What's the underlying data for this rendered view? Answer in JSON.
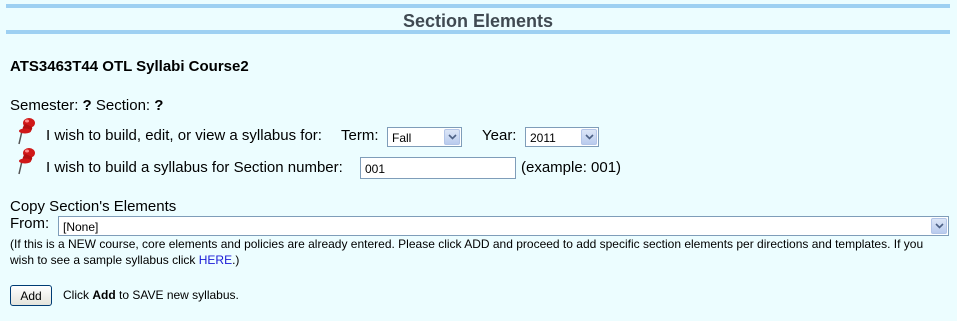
{
  "header": {
    "title": "Section Elements"
  },
  "course": {
    "title": "ATS3463T44 OTL Syllabi Course2"
  },
  "semester": {
    "semester_label": "Semester:",
    "semester_value": "?",
    "section_label": "Section:",
    "section_value": "?"
  },
  "build_row": {
    "text": "I wish to build, edit, or view a syllabus for:",
    "term_label": "Term:",
    "term_value": "Fall",
    "year_label": "Year:",
    "year_value": "2011"
  },
  "section_row": {
    "text": "I wish to build a syllabus for Section number:",
    "section_number_value": "001",
    "example_text": "(example: 001)"
  },
  "copy": {
    "heading": "Copy Section's Elements",
    "from_label": "From:",
    "from_value": "[None]"
  },
  "help": {
    "text_before_link": "(If this is a NEW course, core elements and policies are already entered. Please click ADD and proceed to add specific section elements per directions and templates. If you wish to see a sample syllabus click ",
    "link_text": "HERE",
    "text_after_link": ".)"
  },
  "actions": {
    "add_label": "Add",
    "hint_prefix": "Click",
    "hint_bold": "Add",
    "hint_suffix": "to SAVE new syllabus."
  },
  "colors": {
    "background": "#ecfdff",
    "header_rule": "#9ed0f2",
    "link": "#1a1ad6",
    "pin": "#d01818"
  },
  "icons": [
    "pushpin-icon",
    "chevron-down-icon"
  ]
}
